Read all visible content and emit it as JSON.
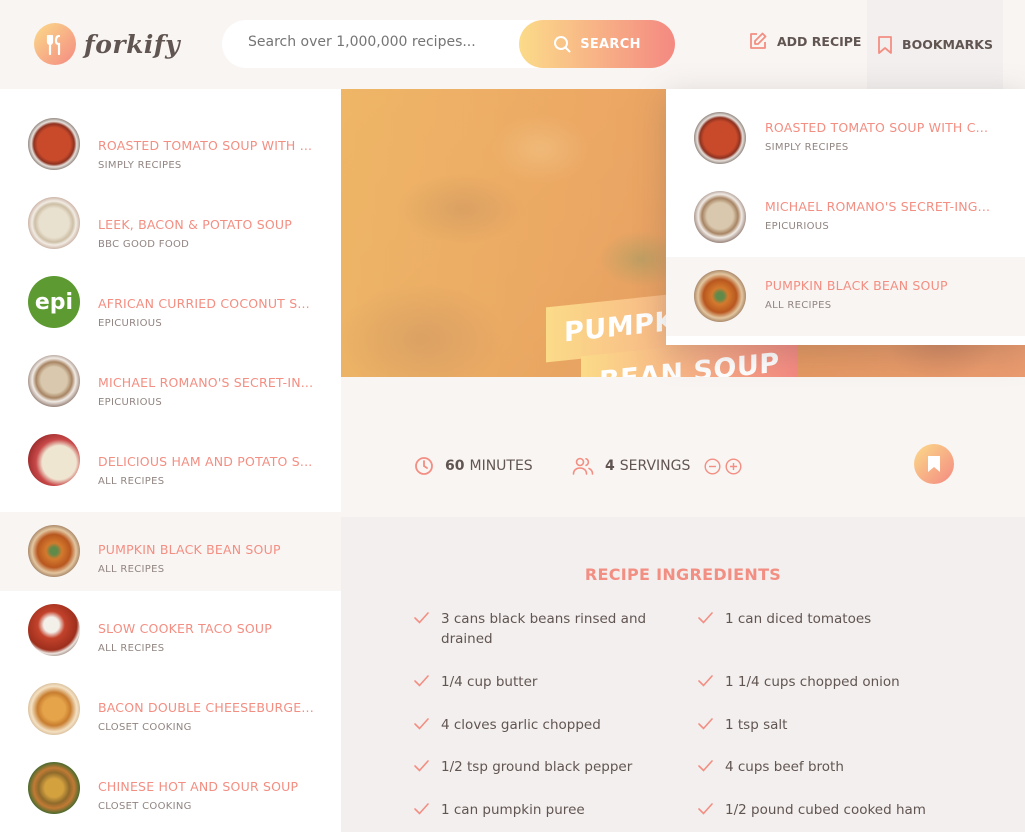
{
  "app": {
    "name": "forkify"
  },
  "header": {
    "search_placeholder": "Search over 1,000,000 recipes...",
    "search_button": "SEARCH",
    "add_recipe": "ADD RECIPE",
    "bookmarks": "BOOKMARKS"
  },
  "results": [
    {
      "title": "ROASTED TOMATO SOUP WITH ...",
      "publisher": "SIMPLY RECIPES",
      "thumb": "tomato-soup"
    },
    {
      "title": "LEEK, BACON & POTATO SOUP",
      "publisher": "BBC GOOD FOOD",
      "thumb": "leek-soup"
    },
    {
      "title": "AFRICAN CURRIED COCONUT S...",
      "publisher": "EPICURIOUS",
      "thumb": "epi-logo",
      "logo_text": "epi"
    },
    {
      "title": "MICHAEL ROMANO'S SECRET-IN...",
      "publisher": "EPICURIOUS",
      "thumb": "romano-soup"
    },
    {
      "title": "DELICIOUS HAM AND POTATO S...",
      "publisher": "ALL RECIPES",
      "thumb": "ham-soup"
    },
    {
      "title": "PUMPKIN BLACK BEAN SOUP",
      "publisher": "ALL RECIPES",
      "thumb": "pumpkin-soup",
      "active": true
    },
    {
      "title": "SLOW COOKER TACO SOUP",
      "publisher": "ALL RECIPES",
      "thumb": "taco-soup"
    },
    {
      "title": "BACON DOUBLE CHEESEBURGE...",
      "publisher": "CLOSET COOKING",
      "thumb": "cheeseburger-soup"
    },
    {
      "title": "CHINESE HOT AND SOUR SOUP",
      "publisher": "CLOSET COOKING",
      "thumb": "hot-sour-soup"
    }
  ],
  "bookmarks": [
    {
      "title": "ROASTED TOMATO SOUP WITH C...",
      "publisher": "SIMPLY RECIPES",
      "thumb": "tomato-soup"
    },
    {
      "title": "MICHAEL ROMANO'S SECRET-ING...",
      "publisher": "EPICURIOUS",
      "thumb": "romano-soup"
    },
    {
      "title": "PUMPKIN BLACK BEAN SOUP",
      "publisher": "ALL RECIPES",
      "thumb": "pumpkin-soup",
      "active": true
    }
  ],
  "recipe": {
    "title_line1": "PUMPKIN BLACK",
    "title_line2": "BEAN SOUP",
    "cooking_time": "60",
    "cooking_time_unit": "MINUTES",
    "servings": "4",
    "servings_unit": "SERVINGS",
    "ingredients_heading": "RECIPE INGREDIENTS",
    "ingredients": [
      "3 cans black beans rinsed and drained",
      "1 can diced tomatoes",
      "1/4 cup butter",
      "1 1/4 cups chopped onion",
      "4 cloves garlic chopped",
      "1 tsp salt",
      "1/2 tsp ground black pepper",
      "4 cups beef broth",
      "1 can pumpkin puree",
      "1/2 pound cubed cooked ham"
    ]
  },
  "colors": {
    "accent": "#f38e82",
    "gradient_start": "#fbdb89",
    "gradient_end": "#f48982",
    "text": "#615551"
  }
}
